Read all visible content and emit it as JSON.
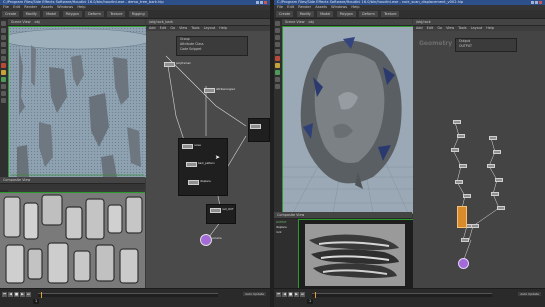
{
  "left": {
    "title": "C:/Program Files/Side Effects Software/Houdini 16.0/bin/houdini.exe - demo_tree_bark.hip",
    "menu": [
      "File",
      "Edit",
      "Render",
      "Assets",
      "Windows",
      "Help"
    ],
    "shelf_tabs": [
      "Create",
      "Modify",
      "Model",
      "Polygon",
      "Deform",
      "Texture",
      "Rigging"
    ],
    "viewport_tab": "Scene View",
    "viewport_path": "obj",
    "net_tab": "/obj/rock_bark",
    "net_menu": [
      "Add",
      "Edit",
      "Go",
      "View",
      "Tools",
      "Layout",
      "Help"
    ],
    "node_labels": [
      "polyframe1",
      "attribwrangle1",
      "noise",
      "bark_pattern",
      "displace",
      "merge1",
      "null_OUT",
      "volume"
    ],
    "param_labels": [
      "Group",
      "Attribute Class",
      "Code Snippet"
    ],
    "composite_tab": "Composite View",
    "frame": "1",
    "stat_right": "Auto Update"
  },
  "right": {
    "title": "C:/Program Files/Side Effects Software/Houdini 16.0/bin/houdini.exe - rock_scan_displacement_v002.hip",
    "menu": [
      "File",
      "Edit",
      "Render",
      "Assets",
      "Windows",
      "Help"
    ],
    "shelf_tabs": [
      "Create",
      "Modify",
      "Model",
      "Polygon",
      "Deform",
      "Texture"
    ],
    "viewport_tab": "Scene View",
    "viewport_path": "obj",
    "net_tab": "/obj/rock",
    "net_menu": [
      "Add",
      "Edit",
      "Go",
      "View",
      "Tools",
      "Layout",
      "Help"
    ],
    "net_title": "Geometry",
    "param_labels": [
      "Output",
      "OUTPUT"
    ],
    "comp_labels": [
      "OUTPUT",
      "displace",
      "rock"
    ],
    "composite_tab": "Composite View",
    "frame": "1",
    "stat_right": "Auto Update"
  },
  "colors": {
    "title_blue": "#2d4f8a",
    "viewport_bg": "#9aa9b5",
    "node_purple": "#a36ad8",
    "node_orange": "#d98a2b",
    "timeline_marker": "#e2a02e"
  }
}
